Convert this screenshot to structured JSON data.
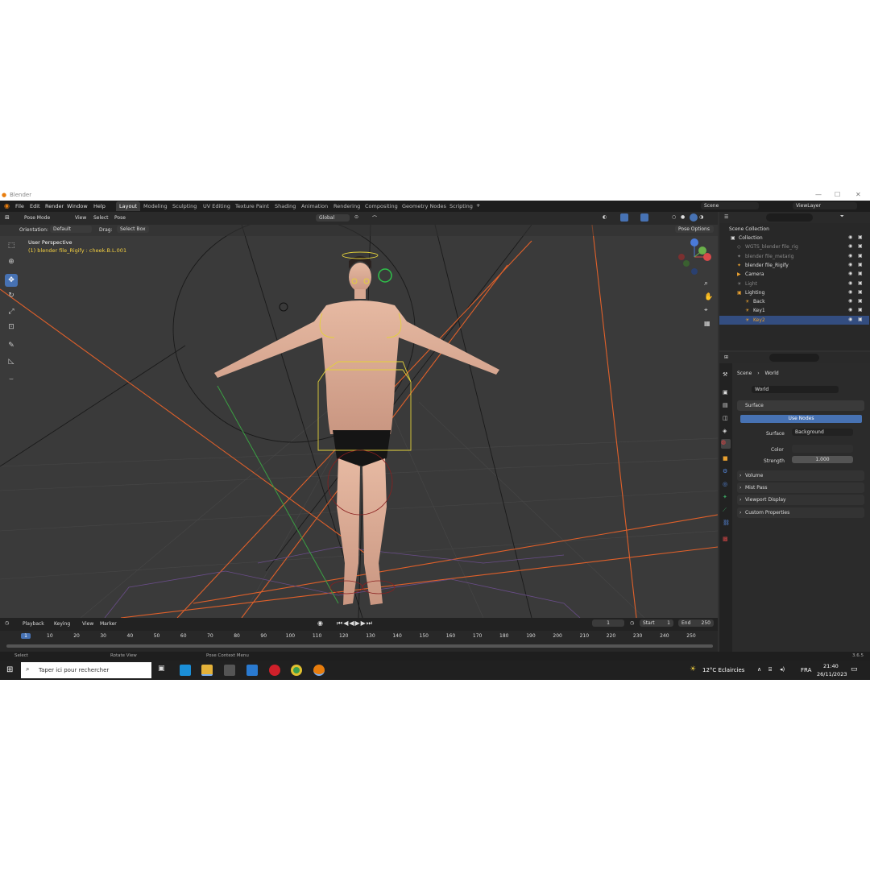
{
  "window": {
    "title": "Blender",
    "min": "—",
    "max": "☐",
    "close": "✕"
  },
  "menu": [
    "File",
    "Edit",
    "Render",
    "Window",
    "Help"
  ],
  "workspaces": [
    "Layout",
    "Modeling",
    "Sculpting",
    "UV Editing",
    "Texture Paint",
    "Shading",
    "Animation",
    "Rendering",
    "Compositing",
    "Geometry Nodes",
    "Scripting"
  ],
  "scene": {
    "label": "Scene",
    "viewlayer": "ViewLayer"
  },
  "viewport_header": {
    "mode": "Pose Mode",
    "view": "View",
    "select": "Select",
    "pose": "Pose",
    "orientation_label": "Global"
  },
  "tool_settings": {
    "orientation_label": "Orientation:",
    "orientation_value": "Default",
    "drag_label": "Drag:",
    "drag_value": "Select Box",
    "pose_options": "Pose Options"
  },
  "overlay": {
    "line1": "User Perspective",
    "line2": "(1) blender file_Rigify : cheek.B.L.001"
  },
  "outliner": {
    "title": "Scene Collection",
    "items": [
      {
        "label": "Collection",
        "depth": 1
      },
      {
        "label": "WGTS_blender file_rig",
        "depth": 2
      },
      {
        "label": "blender file_metarig",
        "depth": 2
      },
      {
        "label": "blender file_Rigify",
        "depth": 2
      },
      {
        "label": "Camera",
        "depth": 2
      },
      {
        "label": "Light",
        "depth": 2
      },
      {
        "label": "Lighting",
        "depth": 2
      },
      {
        "label": "Back",
        "depth": 3
      },
      {
        "label": "Key1",
        "depth": 3
      },
      {
        "label": "Key2",
        "depth": 3
      }
    ]
  },
  "properties": {
    "breadcrumb": [
      "Scene",
      "World"
    ],
    "world_name": "World",
    "surface_header": "Surface",
    "use_nodes": "Use Nodes",
    "surface_label": "Surface",
    "surface_value": "Background",
    "color_label": "Color",
    "strength_label": "Strength",
    "strength_value": "1.000",
    "panels": [
      "Volume",
      "Mist Pass",
      "Viewport Display",
      "Custom Properties"
    ]
  },
  "timeline": {
    "menu": [
      "Playback",
      "Keying",
      "View",
      "Marker"
    ],
    "current_frame": "1",
    "start_label": "Start",
    "start_value": "1",
    "end_label": "End",
    "end_value": "250",
    "ticks": [
      "1",
      "10",
      "20",
      "30",
      "40",
      "50",
      "60",
      "70",
      "80",
      "90",
      "100",
      "110",
      "120",
      "130",
      "140",
      "150",
      "160",
      "170",
      "180",
      "190",
      "200",
      "210",
      "220",
      "230",
      "240",
      "250"
    ]
  },
  "status": {
    "select": "Select",
    "rotate": "Rotate View",
    "context": "Pose Context Menu",
    "version": "3.6.5"
  },
  "taskbar": {
    "search_placeholder": "Taper ici pour rechercher",
    "weather": "12°C  Eclaircies",
    "lang": "FRA",
    "time": "21:40",
    "date": "26/11/2023"
  },
  "colors": {
    "accent": "#4772b3",
    "selection": "#334d80",
    "orange_lines": "#e0602a"
  }
}
